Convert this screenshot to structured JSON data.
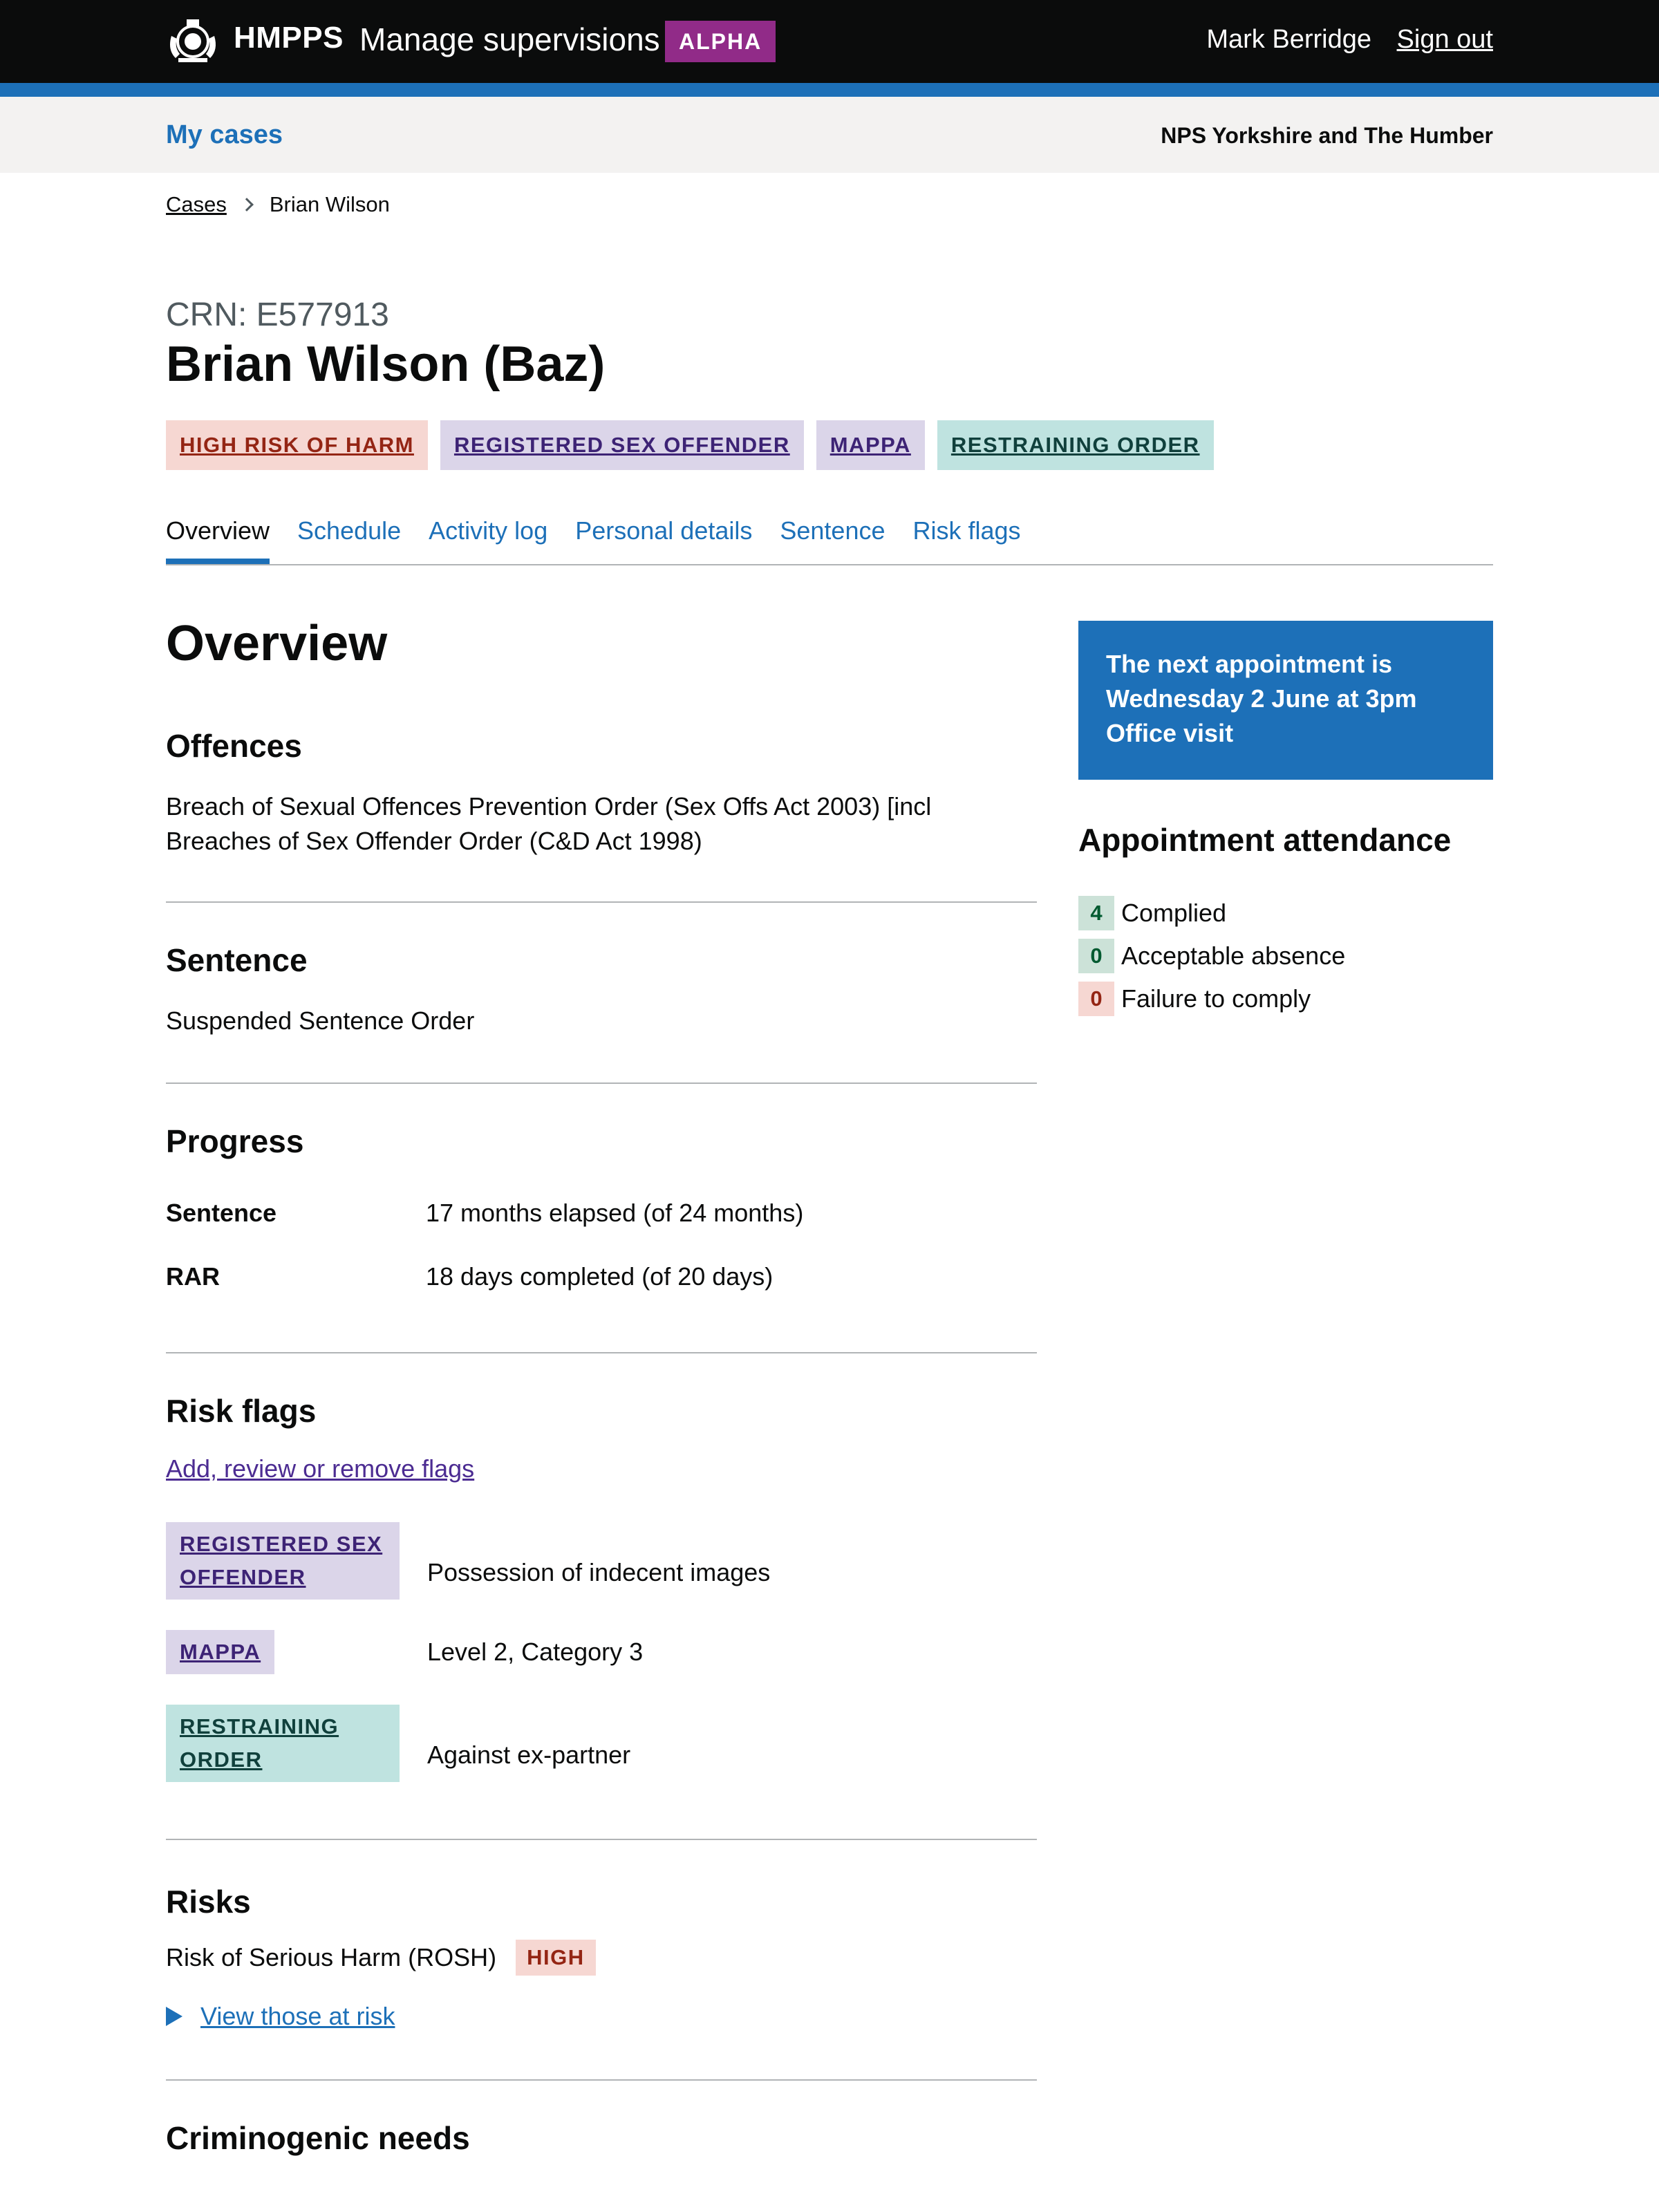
{
  "header": {
    "brand": "HMPPS",
    "service_name": "Manage supervisions",
    "phase": "ALPHA",
    "user_name": "Mark Berridge",
    "sign_out": "Sign out",
    "crest_icon": "royal-crest-icon"
  },
  "subnav": {
    "my_cases": "My cases",
    "region": "NPS Yorkshire and The Humber"
  },
  "breadcrumb": {
    "cases": "Cases",
    "current": "Brian Wilson"
  },
  "person": {
    "crn": "CRN: E577913",
    "name": "Brian Wilson (Baz)"
  },
  "flags": [
    {
      "label": "HIGH RISK OF HARM",
      "color": "#942514",
      "bg": "#f6d7d2"
    },
    {
      "label": "REGISTERED SEX OFFENDER",
      "color": "#3d2375",
      "bg": "#dbd5e9"
    },
    {
      "label": "MAPPA",
      "color": "#3d2375",
      "bg": "#dbd5e9"
    },
    {
      "label": "RESTRAINING ORDER",
      "color": "#10403c",
      "bg": "#bfe3e0"
    }
  ],
  "tabs": [
    "Overview",
    "Schedule",
    "Activity log",
    "Personal details",
    "Sentence",
    "Risk flags"
  ],
  "overview": {
    "title": "Overview",
    "offences_title": "Offences",
    "offences_text": "Breach of Sexual Offences Prevention Order (Sex Offs Act 2003) [incl Breaches of Sex Offender Order (C&D Act 1998)",
    "sentence_title": "Sentence",
    "sentence_text": "Suspended Sentence Order",
    "progress_title": "Progress",
    "progress": [
      {
        "key": "Sentence",
        "value": "17 months elapsed (of 24 months)"
      },
      {
        "key": "RAR",
        "value": "18 days completed (of 20 days)"
      }
    ],
    "risk_flags_title": "Risk flags",
    "risk_flags_link": "Add, review or remove flags",
    "risk_flags": [
      {
        "label": "REGISTERED SEX OFFENDER",
        "desc": "Possession of indecent images"
      },
      {
        "label": "MAPPA",
        "desc": "Level 2, Category 3"
      },
      {
        "label": "RESTRAINING ORDER",
        "desc": "Against ex-partner"
      }
    ],
    "risks_title": "Risks",
    "rosh_label": "Risk of Serious Harm (ROSH)",
    "rosh_level": "HIGH",
    "view_at_risk": "View those at risk",
    "next_section_title": "Criminogenic needs"
  },
  "sidebar": {
    "next_appointment": [
      "The next appointment is",
      "Wednesday 2 June at 3pm",
      "Office visit"
    ],
    "attendance_title": "Appointment attendance",
    "attendance": [
      {
        "count": "4",
        "label": "Complied",
        "status": "green"
      },
      {
        "count": "0",
        "label": "Acceptable absence",
        "status": "green"
      },
      {
        "count": "0",
        "label": "Failure to comply",
        "status": "red"
      }
    ]
  },
  "colors": {
    "header_bg": "#0b0c0c",
    "brand_blue": "#1d70b8",
    "alpha_tag": "#912b88",
    "link_visited": "#4c2c92"
  }
}
